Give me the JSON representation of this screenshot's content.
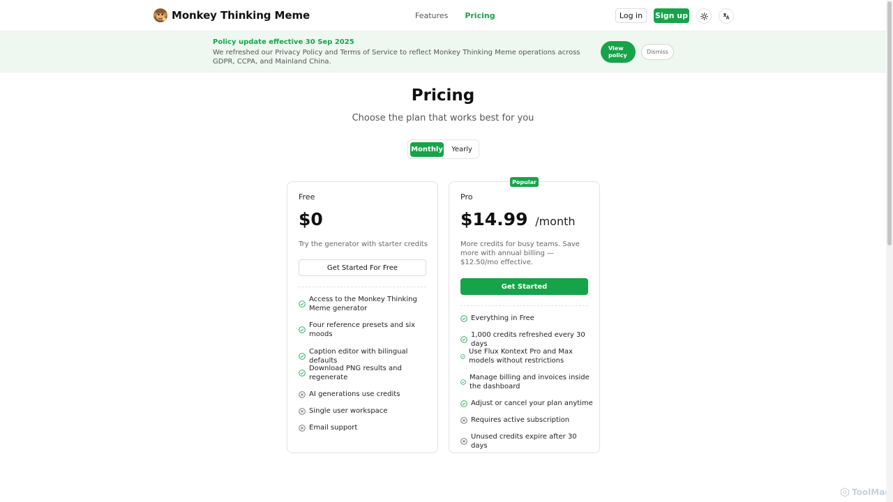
{
  "header": {
    "brand": "Monkey Thinking Meme",
    "nav": [
      {
        "label": "Features",
        "active": false
      },
      {
        "label": "Pricing",
        "active": true
      }
    ],
    "login_label": "Log in",
    "signup_label": "Sign up",
    "icons": [
      "sun-icon",
      "translate-icon"
    ]
  },
  "banner": {
    "title": "Policy update effective 30 Sep 2025",
    "text": "We refreshed our Privacy Policy and Terms of Service to reflect Monkey Thinking Meme operations across GDPR, CCPA, and Mainland China.",
    "view_line1": "View",
    "view_line2": "policy",
    "dismiss_label": "Dismiss"
  },
  "pricing": {
    "title": "Pricing",
    "subtitle": "Choose the plan that works best for you",
    "toggle": {
      "monthly": "Monthly",
      "yearly": "Yearly",
      "selected": "Monthly"
    }
  },
  "plans": [
    {
      "name": "Free",
      "price": "$0",
      "period": "",
      "description": "Try the generator with starter credits",
      "cta": "Get Started For Free",
      "features": [
        {
          "text": "Access to the Monkey Thinking Meme generator",
          "included": true
        },
        {
          "text": "Four reference presets and six moods",
          "included": true
        },
        {
          "text": "Caption editor with bilingual defaults",
          "included": true
        },
        {
          "text": "Download PNG results and regenerate",
          "included": true
        },
        {
          "text": "AI generations use credits",
          "included": false
        },
        {
          "text": "Single user workspace",
          "included": false
        },
        {
          "text": "Email support",
          "included": false
        }
      ]
    },
    {
      "name": "Pro",
      "badge": "Popular",
      "price": "$14.99",
      "period": "/month",
      "description": "More credits for busy teams. Save more with annual billing — $12.50/mo effective.",
      "cta": "Get Started",
      "features": [
        {
          "text": "Everything in Free",
          "included": true
        },
        {
          "text": "1,000 credits refreshed every 30 days",
          "included": true
        },
        {
          "text": "Use Flux Kontext Pro and Max models without restrictions",
          "included": true
        },
        {
          "text": "Manage billing and invoices inside the dashboard",
          "included": true
        },
        {
          "text": "Adjust or cancel your plan anytime",
          "included": true
        },
        {
          "text": "Requires active subscription",
          "included": false
        },
        {
          "text": "Unused credits expire after 30 days",
          "included": false
        }
      ]
    }
  ],
  "watermark": "ToolMage",
  "colors": {
    "accent": "#16a34a",
    "banner_bg": "#eef8f1"
  }
}
